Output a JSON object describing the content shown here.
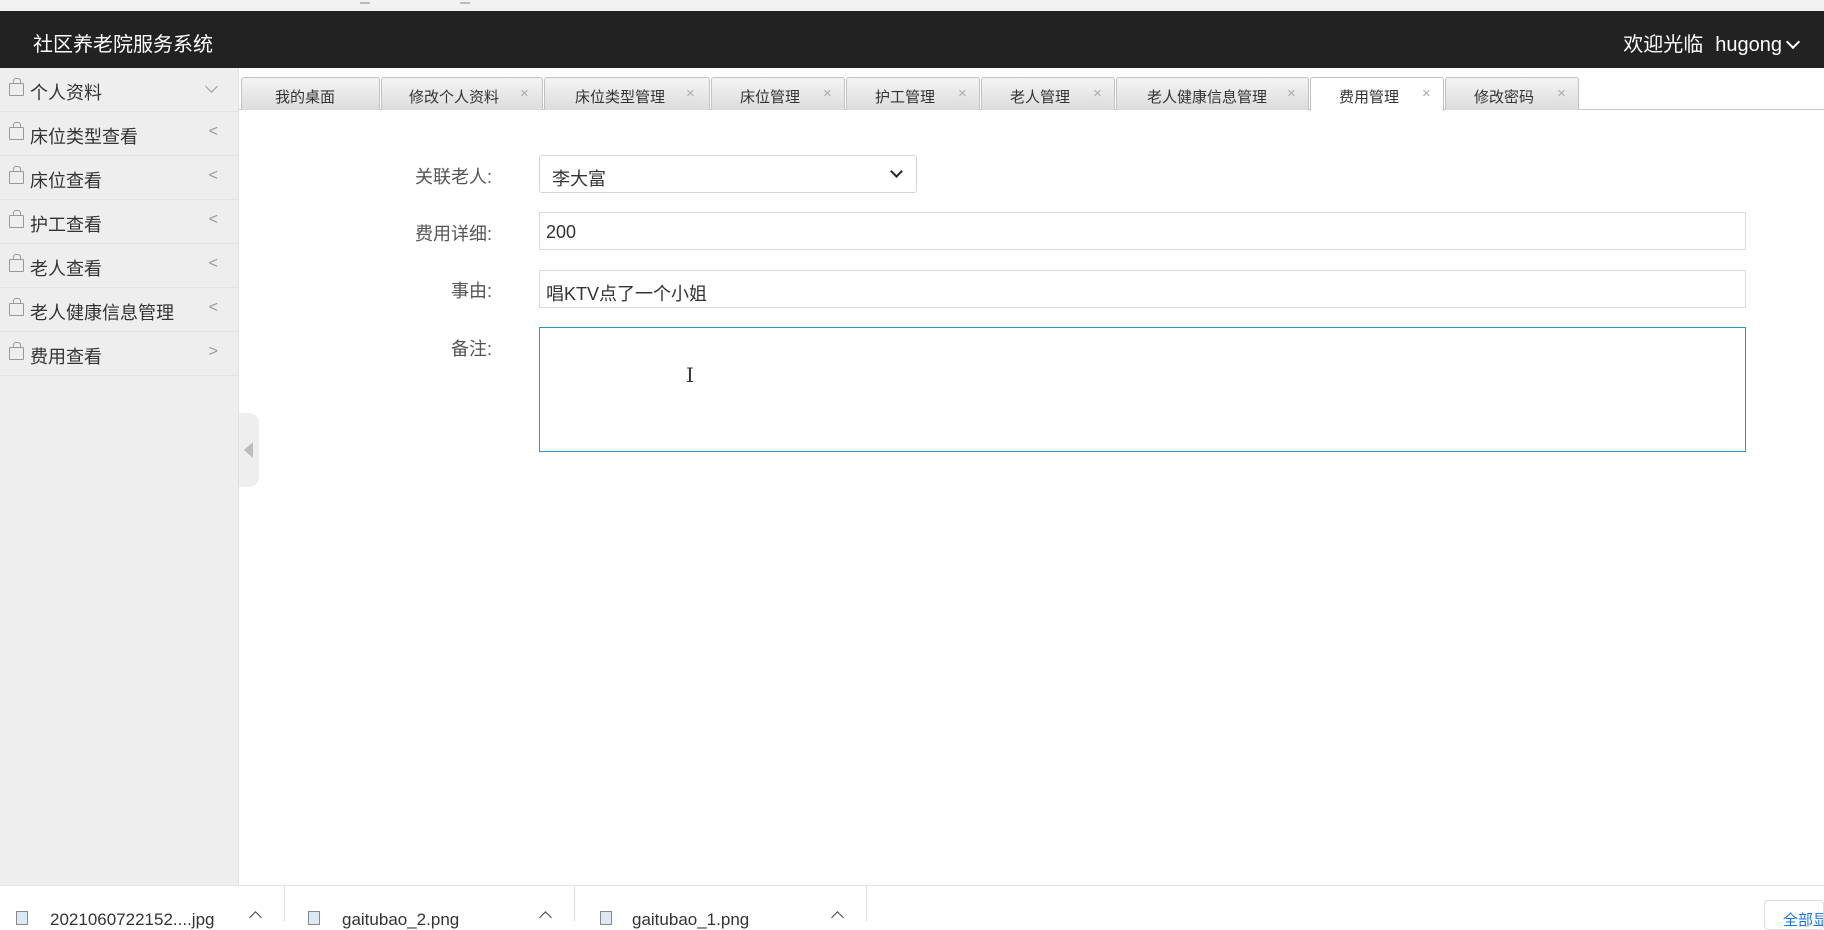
{
  "header": {
    "app_title": "社区养老院服务系统",
    "welcome_text": "欢迎光临",
    "username": "hugong"
  },
  "sidebar": {
    "items": [
      {
        "label": "个人资料",
        "arrow": "down"
      },
      {
        "label": "床位类型查看",
        "arrow": "<"
      },
      {
        "label": "床位查看",
        "arrow": "<"
      },
      {
        "label": "护工查看",
        "arrow": "<"
      },
      {
        "label": "老人查看",
        "arrow": "<"
      },
      {
        "label": "老人健康信息管理",
        "arrow": "<"
      },
      {
        "label": "费用查看",
        "arrow": ">"
      }
    ]
  },
  "tabs": [
    {
      "label": "我的桌面",
      "closable": false,
      "active": false
    },
    {
      "label": "修改个人资料",
      "closable": true,
      "active": false
    },
    {
      "label": "床位类型管理",
      "closable": true,
      "active": false
    },
    {
      "label": "床位管理",
      "closable": true,
      "active": false
    },
    {
      "label": "护工管理",
      "closable": true,
      "active": false
    },
    {
      "label": "老人管理",
      "closable": true,
      "active": false
    },
    {
      "label": "老人健康信息管理",
      "closable": true,
      "active": false
    },
    {
      "label": "费用管理",
      "closable": true,
      "active": true
    },
    {
      "label": "修改密码",
      "closable": true,
      "active": false
    }
  ],
  "tab_close_glyph": "×",
  "form": {
    "elder_label": "关联老人:",
    "elder_value": "李大富",
    "fee_label": "费用详细:",
    "fee_value": "200",
    "reason_label": "事由:",
    "reason_value": "唱KTV点了一个小姐",
    "remark_label": "备注:",
    "remark_value": ""
  },
  "downloads": {
    "files": [
      {
        "name": "2021060722152....jpg"
      },
      {
        "name": "gaitubao_2.png"
      },
      {
        "name": "gaitubao_1.png"
      }
    ],
    "show_all": "全部显示"
  },
  "colors": {
    "header_bg": "#222222",
    "sidebar_bg": "#eeeeee",
    "focus_border": "#1e9fb5"
  }
}
